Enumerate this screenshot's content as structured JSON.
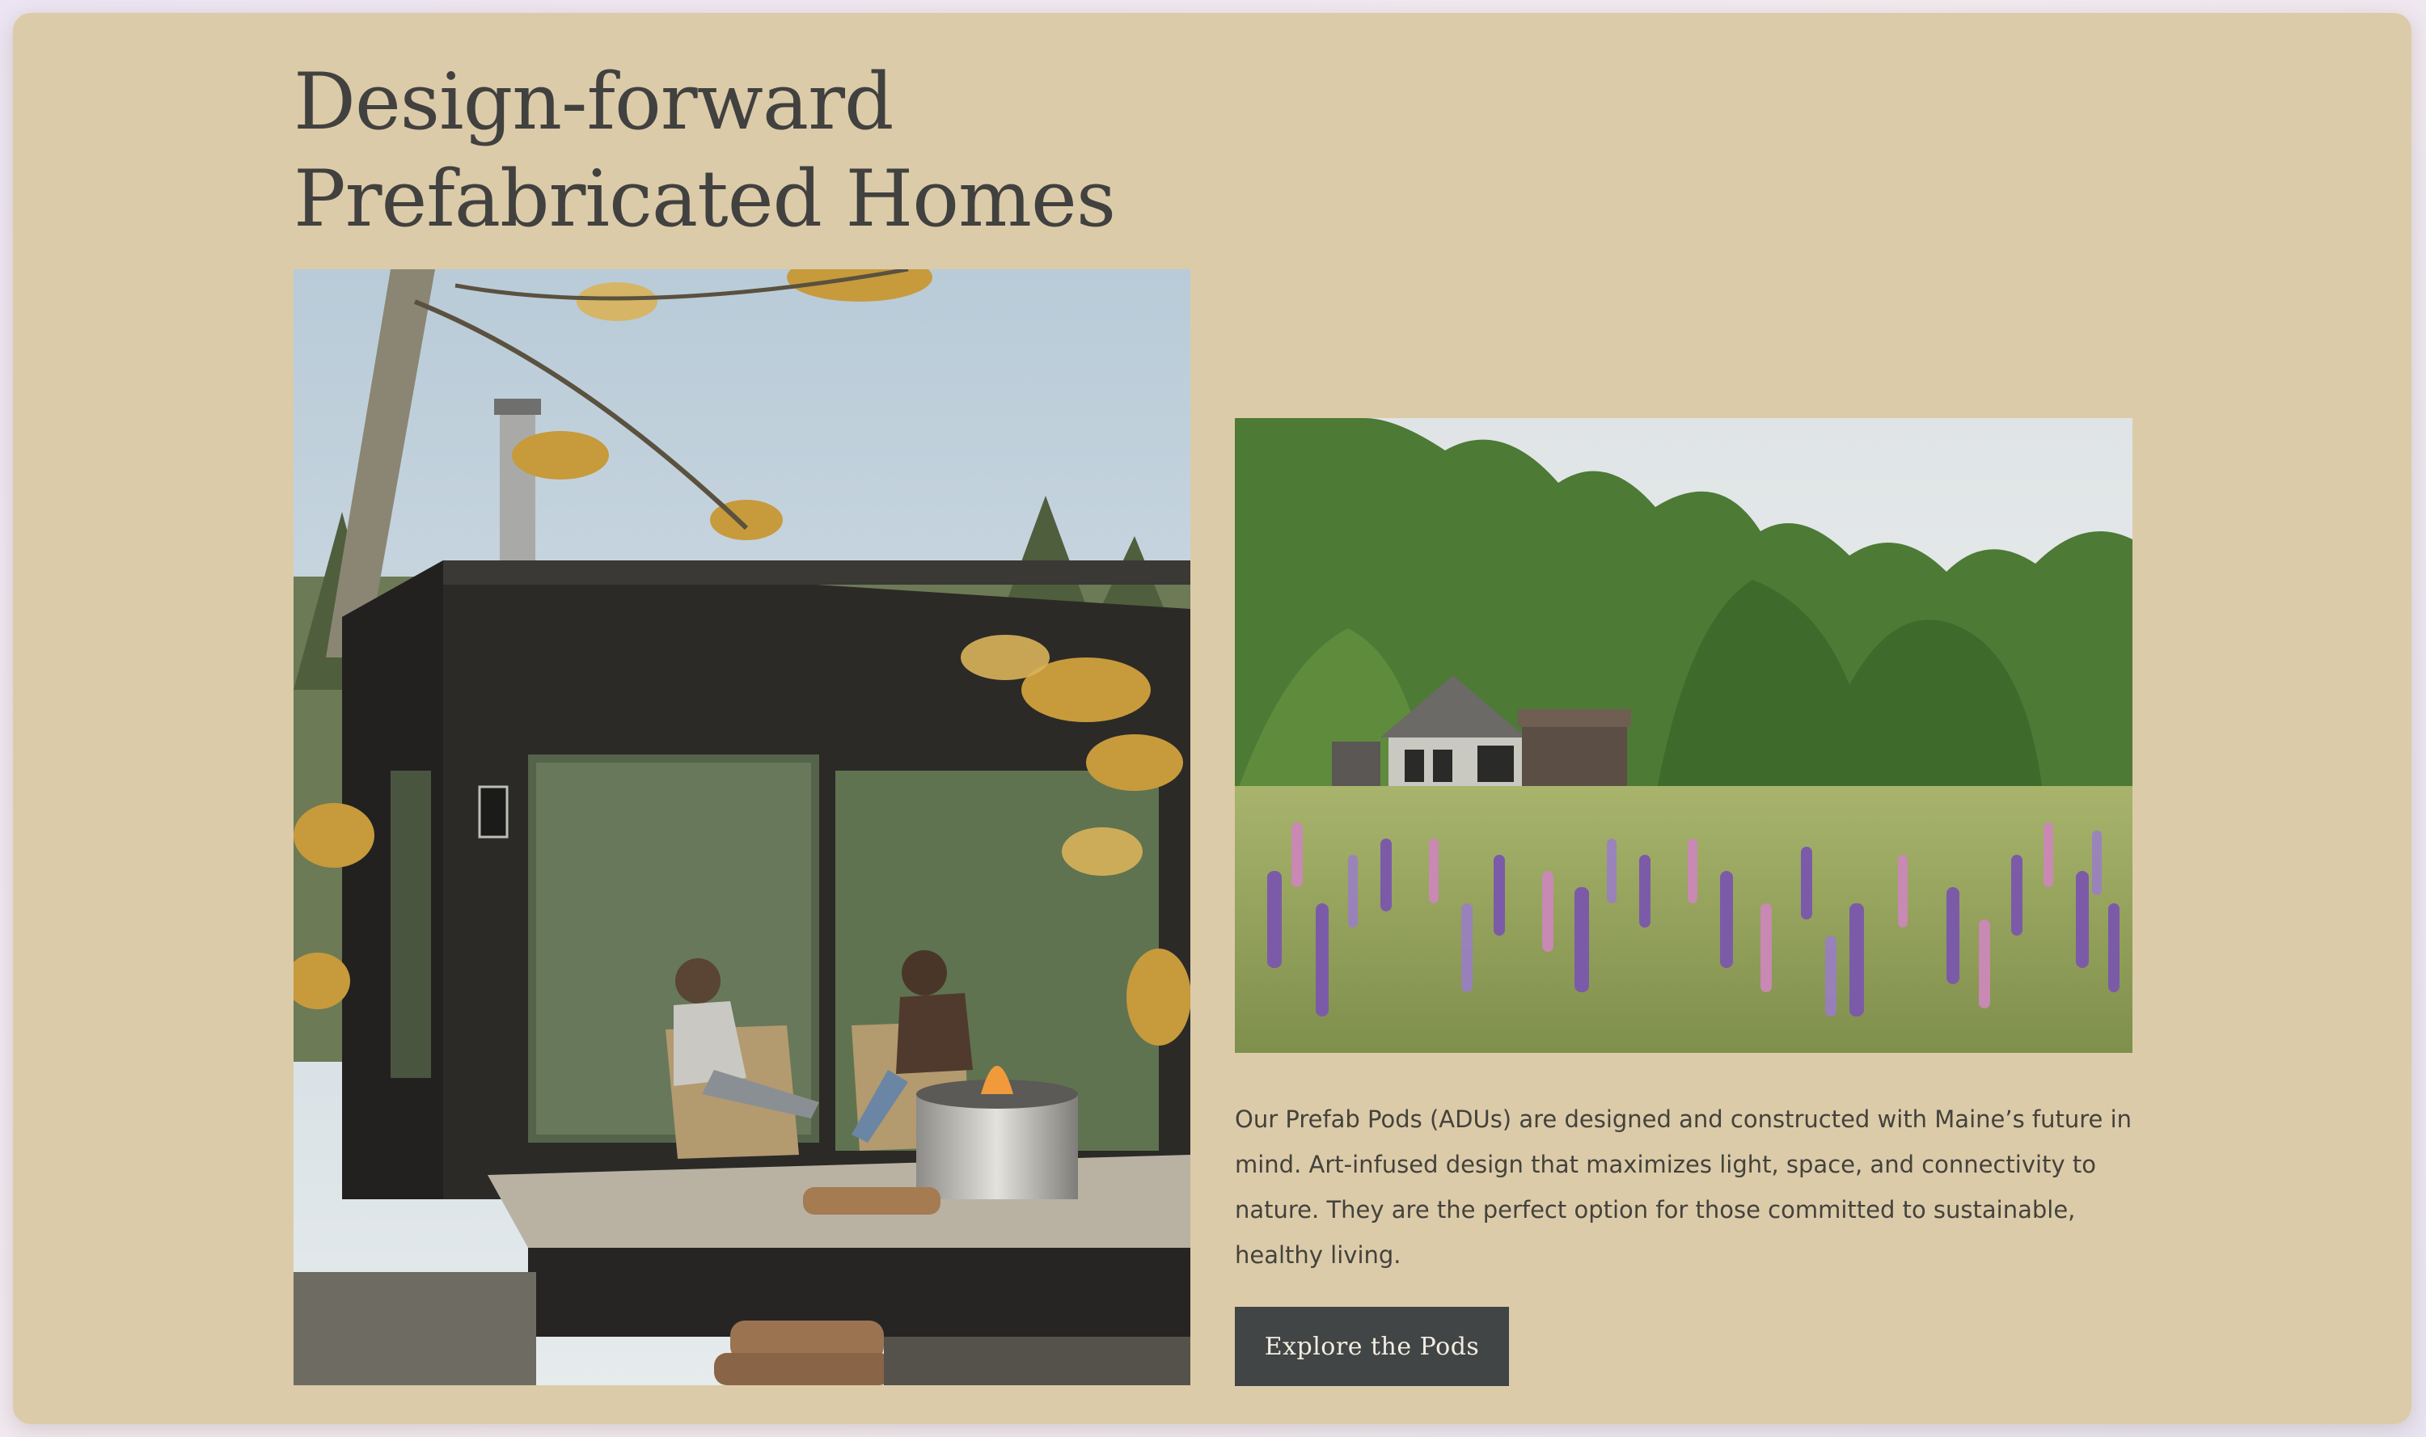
{
  "hero": {
    "title": "Design-forward Prefabricated Homes",
    "description": "Our Prefab Pods (ADUs) are designed and constructed with Maine’s future in mind. Art-infused design that maximizes light, space, and connectivity to nature. They are the perfect option for those committed to sustainable, healthy living.",
    "cta_label": "Explore the Pods"
  },
  "colors": {
    "background": "#dccba9",
    "heading": "#41413f",
    "body_text": "#44423c",
    "button_bg": "#424545",
    "button_text": "#f2ede2"
  }
}
